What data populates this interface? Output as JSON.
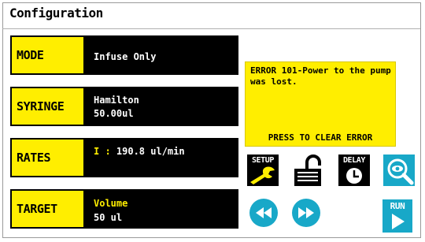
{
  "header": {
    "title": "Configuration"
  },
  "rows": {
    "mode": {
      "label": "MODE",
      "line1": "Infuse Only"
    },
    "syringe": {
      "label": "SYRINGE",
      "line1": "Hamilton",
      "line2": "50.00ul"
    },
    "rates": {
      "label": "RATES",
      "prefix": "I : ",
      "line1": "190.8 ul/min"
    },
    "target": {
      "label": "TARGET",
      "line1": "Volume",
      "line2": "50 ul"
    }
  },
  "error": {
    "message": "ERROR 101-Power to the pump was lost.",
    "clear_label": "PRESS TO CLEAR ERROR"
  },
  "buttons": {
    "setup": "SETUP",
    "delay": "DELAY",
    "run": "RUN",
    "unlock": "unlock-icon",
    "view": "eye-magnifier-icon",
    "rewind": "rewind-icon",
    "fast_forward": "fast-forward-icon"
  },
  "colors": {
    "accent": "#ffee00",
    "button_cyan": "#18a8c8",
    "panel": "#000000"
  }
}
